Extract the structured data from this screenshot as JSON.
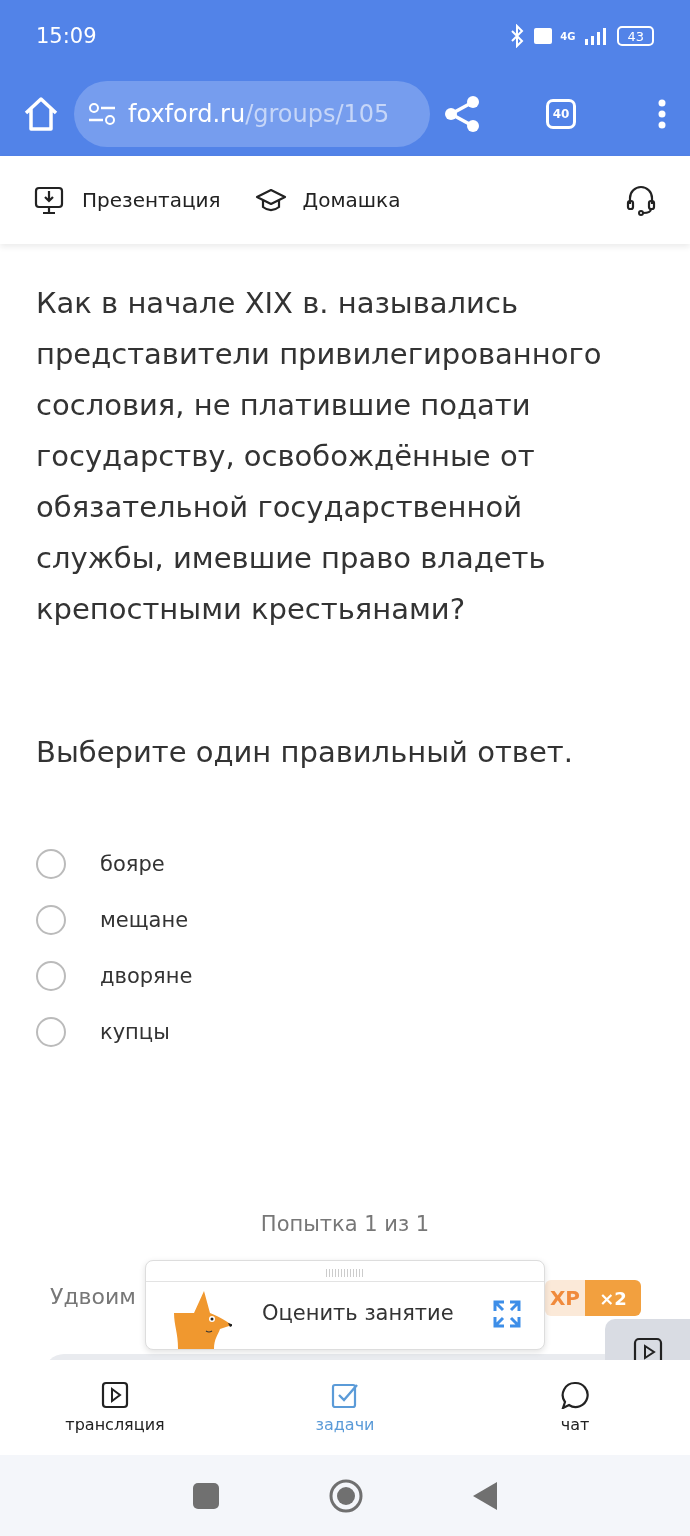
{
  "status_bar": {
    "time": "15:09",
    "network": "4G",
    "battery": "43"
  },
  "browser": {
    "url_host": "foxford.ru",
    "url_path": "/groups/105",
    "tab_count": "40"
  },
  "toolbar": {
    "items": [
      {
        "kind": "presentation",
        "label": "Презентация"
      },
      {
        "kind": "homework",
        "label": "Домашка"
      }
    ]
  },
  "question": {
    "text": "Как в начале XIX в. назывались представители привилегированного сословия, не платившие подати государству, освобождённые от обязательной государственной службы, имевшие право владеть крепостными крестьянами?",
    "instruction": "Выберите один правильный ответ.",
    "options": [
      {
        "label": "бояре",
        "selected": false
      },
      {
        "label": "мещане",
        "selected": false
      },
      {
        "label": "дворяне",
        "selected": false
      },
      {
        "label": "купцы",
        "selected": false
      }
    ]
  },
  "attempt": "Попытка 1 из 1",
  "bonus": {
    "text": "Удвоим",
    "xp": "XP",
    "multiplier": "×2"
  },
  "rating_popup": {
    "label": "Оценить занятие"
  },
  "tabs": [
    {
      "kind": "stream",
      "label": "трансляция",
      "selected": false
    },
    {
      "kind": "tasks",
      "label": "задачи",
      "selected": true
    },
    {
      "kind": "chat",
      "label": "чат",
      "selected": false
    }
  ]
}
